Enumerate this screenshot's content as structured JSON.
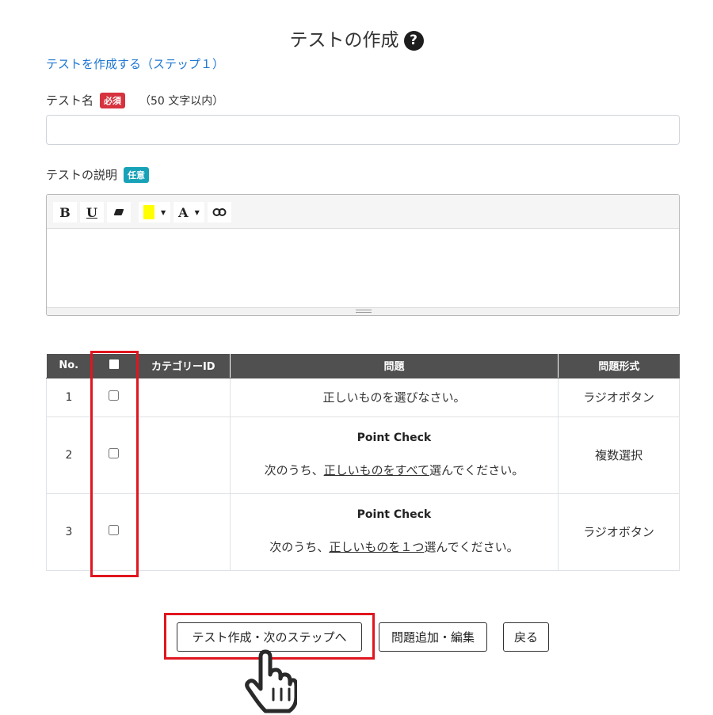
{
  "header": {
    "title": "テストの作成",
    "help_symbol": "?"
  },
  "step_link": "テストを作成する（ステップ１）",
  "name_field": {
    "label": "テスト名",
    "badge": "必須",
    "hint": "（50 文字以内）",
    "value": ""
  },
  "description_field": {
    "label": "テストの説明",
    "badge": "任意"
  },
  "editor": {
    "tools": [
      {
        "name": "bold-button",
        "label": "B"
      },
      {
        "name": "underline-button",
        "label": "U"
      },
      {
        "name": "eraser-button",
        "icon": "eraser-icon"
      },
      {
        "name": "highlight-color-button",
        "icon": "highlight-swatch",
        "color": "#ffff00"
      },
      {
        "name": "font-color-button",
        "label": "A"
      },
      {
        "name": "link-button",
        "icon": "link-icon"
      }
    ],
    "caret": "▼"
  },
  "table": {
    "headers": {
      "no": "No.",
      "category": "カテゴリーID",
      "question": "問題",
      "type": "問題形式"
    },
    "rows": [
      {
        "no": "1",
        "category": "",
        "title": "",
        "text": "正しいものを選びなさい。",
        "type": "ラジオボタン"
      },
      {
        "no": "2",
        "category": "",
        "title": "Point Check",
        "text_pre": "次のうち、",
        "text_u": "正しいものをすべて",
        "text_post": "選んでください。",
        "type": "複数選択"
      },
      {
        "no": "3",
        "category": "",
        "title": "Point Check",
        "text_pre": "次のうち、",
        "text_u": "正しいものを１つ",
        "text_post": "選んでください。",
        "type": "ラジオボタン"
      }
    ]
  },
  "buttons": {
    "create_next": "テスト作成・次のステップへ",
    "add_edit": "問題追加・編集",
    "back": "戻る"
  },
  "colors": {
    "highlight_red": "#e0161f",
    "link_blue": "#1d76d2",
    "header_gray": "#505050"
  }
}
